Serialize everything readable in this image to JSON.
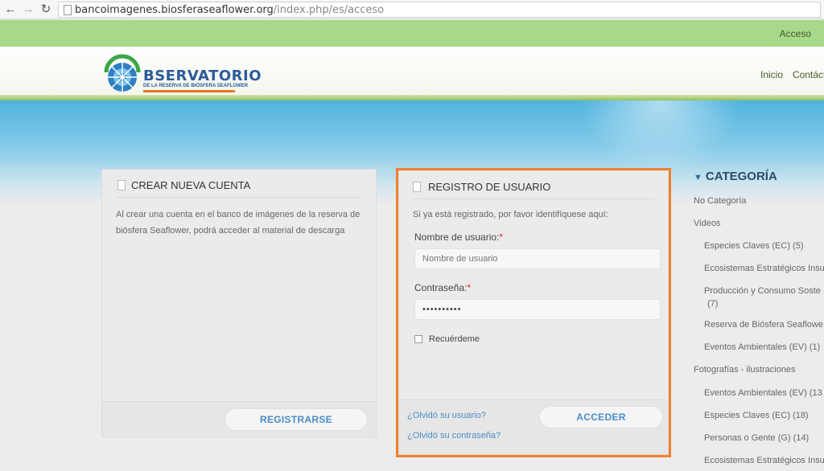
{
  "browser": {
    "url_host": "bancoimagenes.biosferaseaflower.org",
    "url_path": "/index.php/es/acceso"
  },
  "topbar": {
    "acceso": "Acceso"
  },
  "logo": {
    "title": "BSERVATORIO",
    "subtitle": "DE LA RESERVA DE BIÓSFERA SEAFLOWER"
  },
  "menu": {
    "items": [
      "Inicio",
      "Contáct"
    ]
  },
  "create_account": {
    "title": "CREAR NUEVA CUENTA",
    "text": "Al crear una cuenta en el banco de imágenes de la reserva de biósfera Seaflower, podrá acceder al material de descarga",
    "button": "REGISTRARSE"
  },
  "login": {
    "title": "REGISTRO DE USUARIO",
    "intro": "Si ya está registrado, por favor identifíquese aquí:",
    "username_label": "Nombre de usuario:",
    "username_placeholder": "Nombre de usuario",
    "password_label": "Contraseña:",
    "password_value": "••••••••••",
    "required_mark": "*",
    "remember_label": "Recuérdeme",
    "forgot_user": "¿Olvidó su usuario?",
    "forgot_password": "¿Olvidó su contraseña?",
    "button": "ACCEDER"
  },
  "sidebar": {
    "title": "CATEGORÍA",
    "items": [
      "No Categoría",
      "Videos",
      "Especies Claves (EC) (5)",
      "Ecosistemas Estratégicos Insu",
      "Producción y Consumo Soste",
      "(7)",
      "Reserva de Biósfera Seaflowe",
      "Eventos Ambientales (EV) (1)",
      "Fotografías - ilustraciones",
      "Eventos Ambientales (EV) (13",
      "Especies Claves (EC) (18)",
      "Personas o Gente (G) (14)",
      "Ecosistemas Estratégicos Insu"
    ]
  },
  "colors": {
    "accent": "#4a8cc7",
    "topbar": "#a8d88a",
    "highlight": "#f07f2e"
  }
}
